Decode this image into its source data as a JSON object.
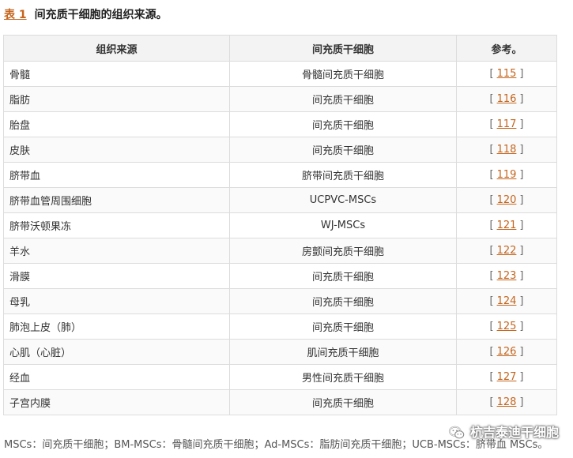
{
  "caption": {
    "tag": "表 1",
    "title": "间充质干细胞的组织来源。"
  },
  "table": {
    "headers": [
      "组织来源",
      "间充质干细胞",
      "参考。"
    ],
    "rows": [
      {
        "source": "骨髓",
        "msc": "骨髓间充质干细胞",
        "ref": "115"
      },
      {
        "source": "脂肪",
        "msc": "间充质干细胞",
        "ref": "116"
      },
      {
        "source": "胎盘",
        "msc": "间充质干细胞",
        "ref": "117"
      },
      {
        "source": "皮肤",
        "msc": "间充质干细胞",
        "ref": "118"
      },
      {
        "source": "脐带血",
        "msc": "脐带间充质干细胞",
        "ref": "119"
      },
      {
        "source": "脐带血管周围细胞",
        "msc": "UCPVC-MSCs",
        "ref": "120"
      },
      {
        "source": "脐带沃顿果冻",
        "msc": "WJ-MSCs",
        "ref": "121"
      },
      {
        "source": "羊水",
        "msc": "房颤间充质干细胞",
        "ref": "122"
      },
      {
        "source": "滑膜",
        "msc": "间充质干细胞",
        "ref": "123"
      },
      {
        "source": "母乳",
        "msc": "间充质干细胞",
        "ref": "124"
      },
      {
        "source": "肺泡上皮（肺）",
        "msc": "间充质干细胞",
        "ref": "125"
      },
      {
        "source": "心肌（心脏）",
        "msc": "肌间充质干细胞",
        "ref": "126"
      },
      {
        "source": "经血",
        "msc": "男性间充质干细胞",
        "ref": "127"
      },
      {
        "source": "子宫内膜",
        "msc": "间充质干细胞",
        "ref": "128"
      }
    ],
    "ref_open": "[",
    "ref_close": "]"
  },
  "footnote": "MSCs：间充质干细胞；BM-MSCs：骨髓间充质干细胞；Ad-MSCs：脂肪间充质干细胞；UCB-MSCs：脐带血 MSCs。",
  "watermark": {
    "text": "杭吉泰迪干细胞",
    "icon": "wechat-icon"
  },
  "colors": {
    "link": "#c4651d",
    "header_bg": "#f3f3f3",
    "border": "#dcdcdc"
  }
}
